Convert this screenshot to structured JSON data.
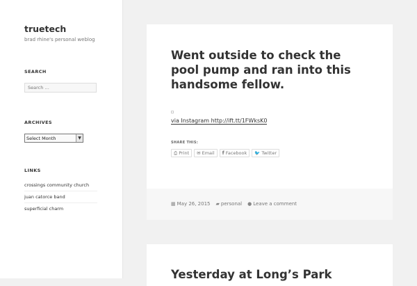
{
  "site": {
    "title": "truetech",
    "description": "brad rhine's personal weblog"
  },
  "sidebar": {
    "search": {
      "title": "SEARCH",
      "placeholder": "Search …"
    },
    "archives": {
      "title": "ARCHIVES",
      "selected": "Select Month"
    },
    "links": {
      "title": "LINKS",
      "items": [
        "crossings community church",
        "juan catorce band",
        "superficial charm"
      ]
    }
  },
  "post1": {
    "title": "Went outside to check the pool pump and ran into this handsome fellow.",
    "via_prefix": "via Instagram ",
    "via_link": "http://ift.tt/1FWksK0",
    "share_title": "SHARE THIS:",
    "share_buttons": [
      {
        "label": "Print",
        "icon": "print-icon"
      },
      {
        "label": "Email",
        "icon": "email-icon"
      },
      {
        "label": "Facebook",
        "icon": "facebook-icon"
      },
      {
        "label": "Twitter",
        "icon": "twitter-icon"
      }
    ],
    "meta": {
      "date": "May 26, 2015",
      "category": "personal",
      "comments": "Leave a comment"
    }
  },
  "post2": {
    "title": "Yesterday at Long’s Park"
  }
}
